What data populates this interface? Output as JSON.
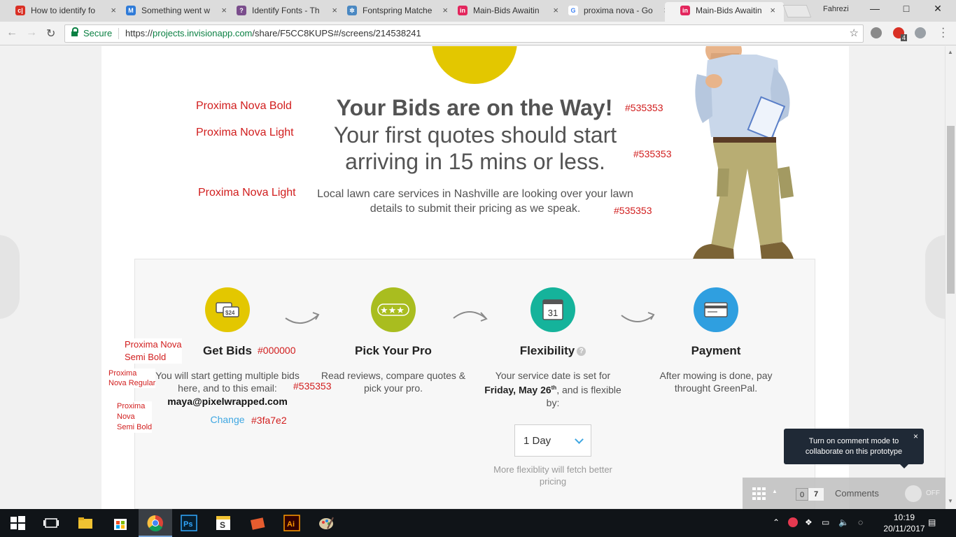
{
  "browser": {
    "tabs": [
      {
        "label": "How to identify fo",
        "icon_color": "#d93025",
        "icon_glyph": "c|"
      },
      {
        "label": "Something went w",
        "icon_color": "#2f7bd8",
        "icon_glyph": "M"
      },
      {
        "label": "Identify Fonts - Th",
        "icon_color": "#7a4d8c",
        "icon_glyph": "?"
      },
      {
        "label": "Fontspring Matche",
        "icon_color": "#4a88c2",
        "icon_glyph": "✲"
      },
      {
        "label": "Main-Bids Awaitin",
        "icon_color": "#e3265d",
        "icon_glyph": "in"
      },
      {
        "label": "proxima nova - Go",
        "icon_color": "#ffffff",
        "icon_glyph": "G"
      },
      {
        "label": "Main-Bids Awaitin",
        "icon_color": "#e3265d",
        "icon_glyph": "in"
      }
    ],
    "profile_name": "Fahrezi",
    "secure_label": "Secure",
    "url_prefix": "https://",
    "url_host": "projects.invisionapp.com",
    "url_path": "/share/F5CC8KUPS#/screens/214538241",
    "ext_badge": "4"
  },
  "page": {
    "headline": "Your Bids are on the Way!",
    "subheadline": "Your first quotes should start arriving in 15 mins or less.",
    "lead": "Local lawn care services in Nashville are looking over your lawn details to submit their pricing as we speak.",
    "annotations": {
      "headline_font": "Proxima Nova Bold",
      "headline_color": "#535353",
      "subheadline_font": "Proxima Nova Light",
      "subheadline_color": "#535353",
      "lead_font": "Proxima Nova Light",
      "lead_color": "#535353",
      "step_title_font_1": "Proxima Nova",
      "step_title_font_2": "Semi Bold",
      "step_title_color": "#000000",
      "step_desc_font_1": "Proxima",
      "step_desc_font_2": "Nova Regular",
      "step_desc_color": "#535353",
      "email_font_1": "Proxima",
      "email_font_2": "Nova",
      "email_font_3": "Semi Bold",
      "link_color": "#3fa7e2"
    },
    "steps": [
      {
        "title": "Get Bids",
        "desc": "You will start getting multiple bids here, and to this email:",
        "email": "maya@pixelwrapped.com",
        "link": "Change",
        "color": "#e3c700",
        "icon": "price-tags-icon"
      },
      {
        "title": "Pick Your Pro",
        "desc": "Read reviews, compare quotes & pick your pro.",
        "color": "#a9bd1f",
        "icon": "stars-icon"
      },
      {
        "title": "Flexibility",
        "help": "?",
        "desc_pre": "Your service date is set for",
        "date": "Friday, May 26",
        "date_sup": "th",
        "desc_post": ", and is flexible by:",
        "select_value": "1 Day",
        "note": "More flexiblity will fetch better pricing",
        "color": "#15b39b",
        "icon": "calendar-icon",
        "calendar_day": "31"
      },
      {
        "title": "Payment",
        "desc": "After mowing is done, pay throught GreenPal.",
        "color": "#2f9fe0",
        "icon": "credit-card-icon"
      }
    ]
  },
  "invision": {
    "tooltip": "Turn on comment mode to collaborate on this prototype",
    "count_unread": "0",
    "count_total": "7",
    "comments_label": "Comments",
    "toggle_label": "OFF"
  },
  "taskbar": {
    "time": "10:19",
    "date": "20/11/2017",
    "apps": [
      "windows-start-icon",
      "task-view-icon",
      "file-explorer-icon",
      "store-icon",
      "chrome-icon",
      "photoshop-icon",
      "sketchbook-icon",
      "books-icon",
      "illustrator-icon",
      "paint-icon"
    ]
  }
}
